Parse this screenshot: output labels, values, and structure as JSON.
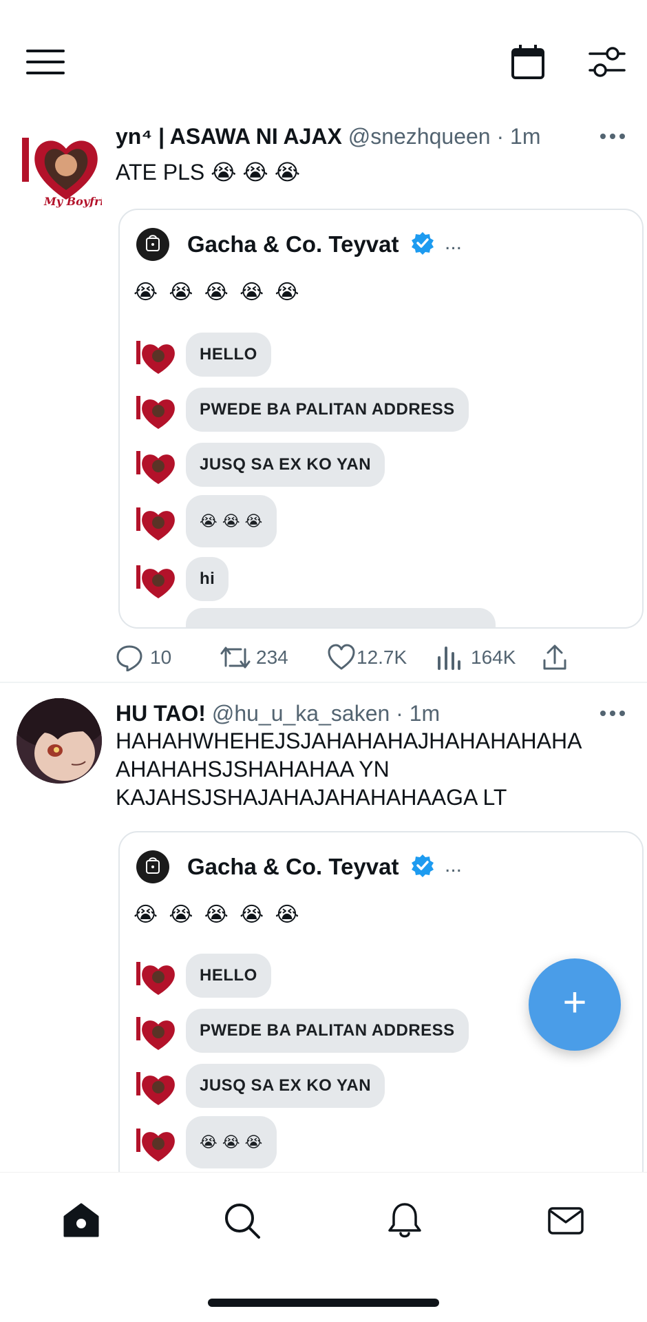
{
  "colors": {
    "accent": "#4a9de8",
    "verified": "#1d9bf0",
    "secondary_text": "#536471",
    "bubble": "#e5e8eb"
  },
  "header": {
    "menu_icon": "hamburger-menu-icon",
    "calendar_icon": "calendar-icon",
    "filter_icon": "sliders-icon"
  },
  "tweets": [
    {
      "display_name": "yn⁴ | ASAWA NI AJAX",
      "handle": "@snezhqueen",
      "time": "· 1m",
      "text": "ATE PLS 😭 😭 😭",
      "quote": {
        "name": "Gacha & Co. Teyvat",
        "more": "...",
        "emojis": "😭 😭 😭 😭 😭",
        "messages": [
          "HELLO",
          "PWEDE BA PALITAN ADDRESS",
          "JUSQ SA EX KO YAN",
          "😭 😭 😭",
          "hi"
        ]
      },
      "stats": {
        "replies": "10",
        "retweets": "234",
        "likes": "12.7K",
        "views": "164K"
      }
    },
    {
      "display_name": "HU TAO!",
      "handle": "@hu_u_ka_saken",
      "time": "· 1m",
      "text_lines": [
        "HAHAHWHEHEJSJAHAHAHAJHAHAHAHAHA",
        "AHAHAHSJSHAHAHAA YN",
        "KAJAHSJSHAJAHAJAHAHAHAAGA LT"
      ],
      "quote": {
        "name": "Gacha & Co. Teyvat",
        "more": "...",
        "emojis": "😭 😭 😭 😭 😭",
        "messages": [
          "HELLO",
          "PWEDE BA PALITAN ADDRESS",
          "JUSQ SA EX KO YAN",
          "😭 😭 😭"
        ]
      }
    }
  ],
  "fab": {
    "label": "+"
  },
  "bottom_nav": [
    "home-icon",
    "search-icon",
    "bell-icon",
    "mail-icon"
  ]
}
